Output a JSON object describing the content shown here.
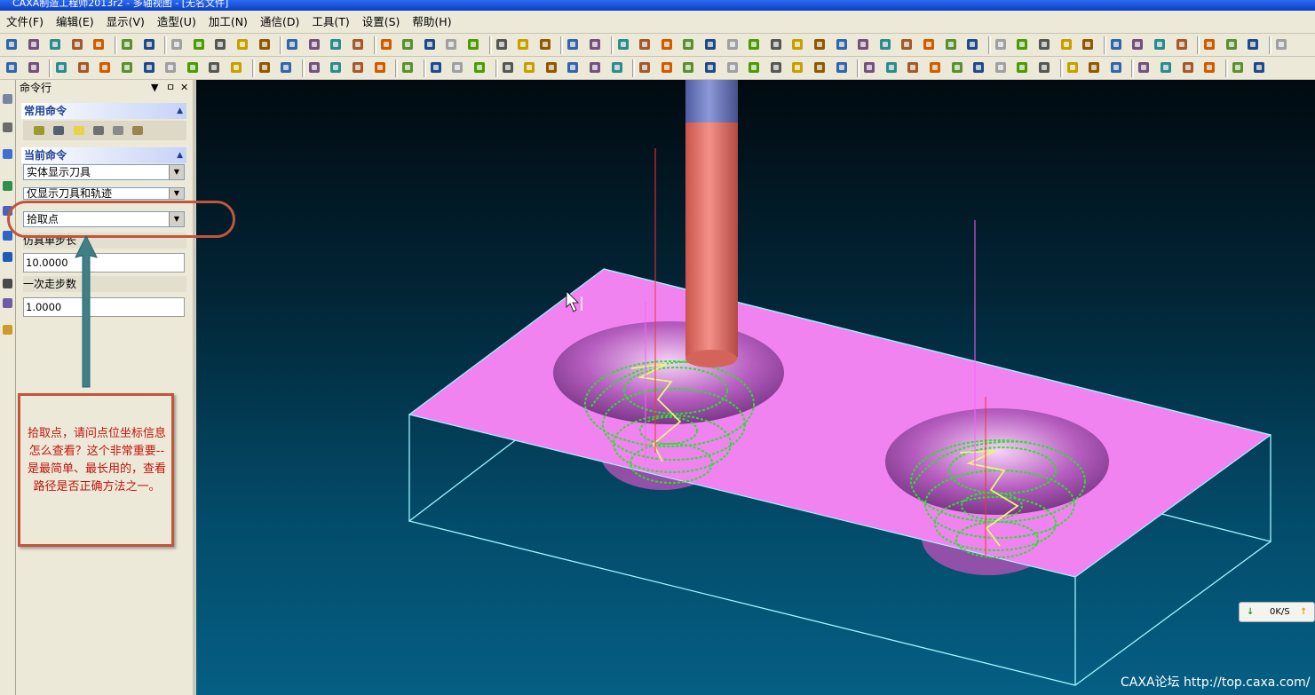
{
  "window": {
    "title": "CAXA制造工程师2013r2 - 多轴视图 - [无名文件]"
  },
  "menu": {
    "items": [
      "文件(F)",
      "编辑(E)",
      "显示(V)",
      "造型(U)",
      "加工(N)",
      "通信(D)",
      "工具(T)",
      "设置(S)",
      "帮助(H)"
    ]
  },
  "panel": {
    "title": "命令行",
    "controls": {
      "dropdown": "▼",
      "pin": "ㅁ",
      "close": "✕"
    },
    "common_commands_label": "常用命令",
    "current_command_label": "当前命令",
    "combos": [
      "实体显示刀具",
      "仅显示刀具和轨迹",
      "拾取点"
    ],
    "step_label": "仿真单步长",
    "step_value": "10.0000",
    "per_step_label": "一次走步数",
    "per_step_value": "1.0000"
  },
  "annotation": {
    "text": "拾取点，请问点位坐标信息怎么查看？这个非常重要--是最简单、最长用的，查看路径是否正确方法之一。"
  },
  "status": {
    "rate": "0K/S"
  },
  "watermark": "CAXA论坛 http://top.caxa.com/",
  "colors": {
    "annotation_red": "#c0563b",
    "stock_pink": "#f183f1",
    "toolpath_green": "#25e32a",
    "tool_shank": "#e8786f",
    "tool_holder": "#6f7fc7",
    "bbox_cyan": "#9ff5ff"
  }
}
